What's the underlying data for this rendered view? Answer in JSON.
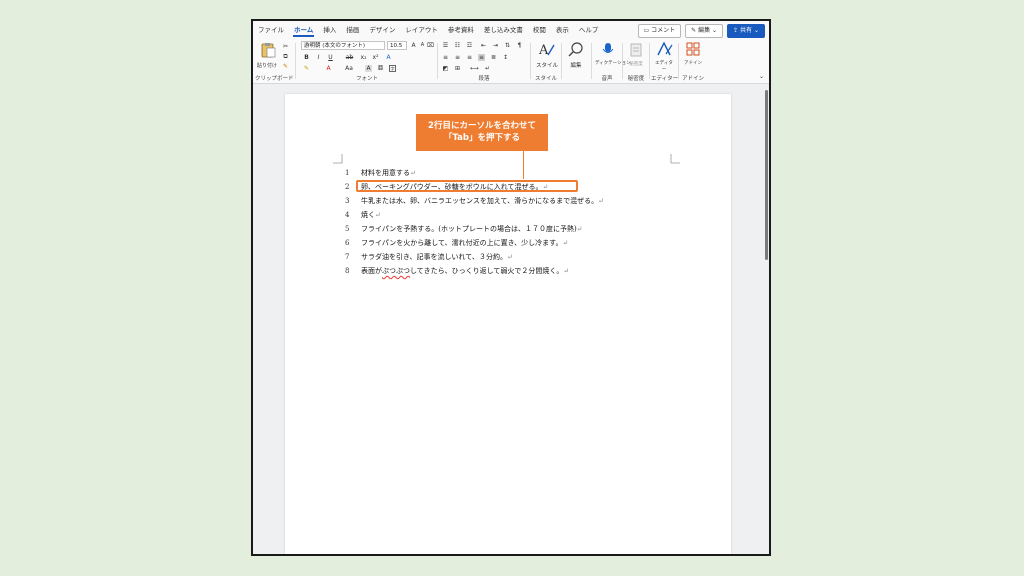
{
  "menu": {
    "tabs": [
      "ファイル",
      "ホーム",
      "挿入",
      "描画",
      "デザイン",
      "レイアウト",
      "参考資料",
      "差し込み文書",
      "校閲",
      "表示",
      "ヘルプ"
    ],
    "active_tab": "ホーム",
    "comment_label": "コメント",
    "edit_label": "編集",
    "share_label": "共有"
  },
  "ribbon": {
    "clipboard": {
      "paste_label": "貼り付け",
      "group_label": "クリップボード"
    },
    "font": {
      "font_name": "游明朝 (本文のフォント)",
      "font_size": "10.5",
      "bold": "B",
      "italic": "I",
      "underline": "U",
      "strike": "ab",
      "sub": "x₂",
      "sup": "x²",
      "case": "Aa",
      "group_label": "フォント"
    },
    "paragraph": {
      "group_label": "段落"
    },
    "styles": {
      "label": "スタイル",
      "group_label": "スタイル"
    },
    "editing": {
      "label": "編集"
    },
    "voice": {
      "label": "ディクテーション",
      "group_label": "音声"
    },
    "sensitivity": {
      "label": "秘密度",
      "group_label": "秘密度"
    },
    "editor": {
      "label": "エディター",
      "group_label": "エディター"
    },
    "addins": {
      "label": "アドイン",
      "group_label": "アドイン"
    }
  },
  "callout": {
    "line1": "2行目にカーソルを合わせて",
    "line2": "「Tab」を押下する"
  },
  "document": {
    "lines": [
      {
        "num": "1",
        "text": "材料を用意する"
      },
      {
        "num": "2",
        "text": "卵、ベーキングパウダー、砂糖をボウルに入れて混ぜる。"
      },
      {
        "num": "3",
        "text": "牛乳または水、卵、バニラエッセンスを加えて、滑らかになるまで混ぜる。"
      },
      {
        "num": "4",
        "text": "焼く"
      },
      {
        "num": "5",
        "text": "フライパンを予熱する。(ホットプレートの場合は、１７０度に予熱)"
      },
      {
        "num": "6",
        "text": "フライパンを火から離して、濡れ付近の上に置き、少し冷ます。"
      },
      {
        "num": "7",
        "text": "サラダ油を引き、記事を流しいれて、３分約。"
      },
      {
        "num": "8",
        "text_before": "表面が",
        "text_squiggle": "ぷつぷつ",
        "text_after": "してきたら、ひっくり返して弱火で２分間焼く。"
      }
    ],
    "para_mark": "↵"
  },
  "colors": {
    "accent": "#ee7d31",
    "brand": "#185abd",
    "background": "#e3efdc"
  }
}
